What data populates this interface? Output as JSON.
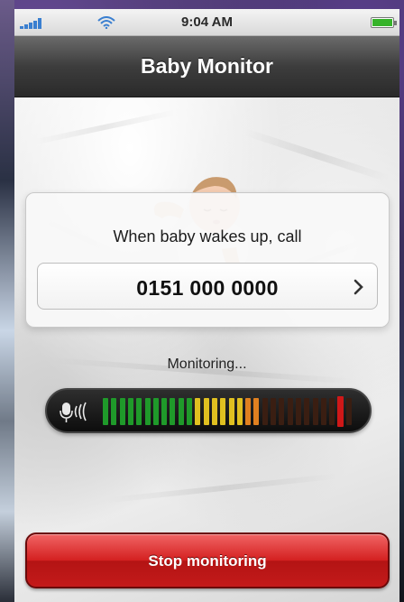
{
  "status_bar": {
    "time": "9:04 AM",
    "icons": [
      "signal-icon",
      "wifi-icon",
      "battery-icon"
    ],
    "accent": "#3a7fd0",
    "battery_color": "#36b32a"
  },
  "nav": {
    "title": "Baby Monitor"
  },
  "call_card": {
    "prompt": "When baby wakes up, call",
    "phone_number": "0151 000 0000",
    "chevron_icon": "chevron-right-icon"
  },
  "monitoring": {
    "label": "Monitoring...",
    "mic_icon": "microphone-icon",
    "level_fraction": 0.63,
    "peak_fraction": 0.93,
    "colors": {
      "low": "#1f9a2a",
      "mid": "#e0c020",
      "high": "#e08020",
      "peak": "#d01818"
    }
  },
  "stop_button": {
    "label": "Stop monitoring",
    "color": "#d42020"
  }
}
